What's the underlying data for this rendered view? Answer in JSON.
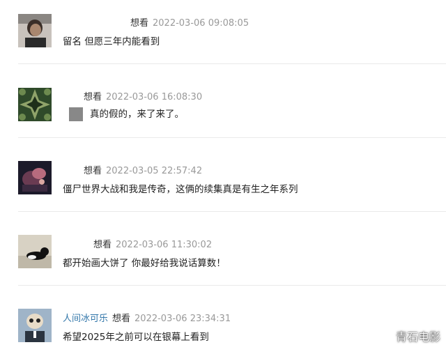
{
  "comments": [
    {
      "user": "",
      "rating": "想看",
      "time": "2022-03-06 09:08:05",
      "text": "留名 但愿三年内能看到"
    },
    {
      "user": "",
      "rating": "想看",
      "time": "2022-03-06 16:08:30",
      "text": "真的假的，来了来了。"
    },
    {
      "user": "",
      "rating": "想看",
      "time": "2022-03-05 22:57:42",
      "text": "僵尸世界大战和我是传奇，这俩的续集真是有生之年系列"
    },
    {
      "user": "",
      "rating": "想看",
      "time": "2022-03-06 11:30:02",
      "text": "都开始画大饼了 你最好给我说话算数！"
    },
    {
      "user": "人间冰可乐",
      "rating": "想看",
      "time": "2022-03-06 23:34:31",
      "text": "希望2025年之前可以在银幕上看到"
    }
  ],
  "watermark": "青石电影",
  "colors": {
    "username": "#3377aa",
    "timestamp": "#999999",
    "divider": "#eaeaea"
  }
}
